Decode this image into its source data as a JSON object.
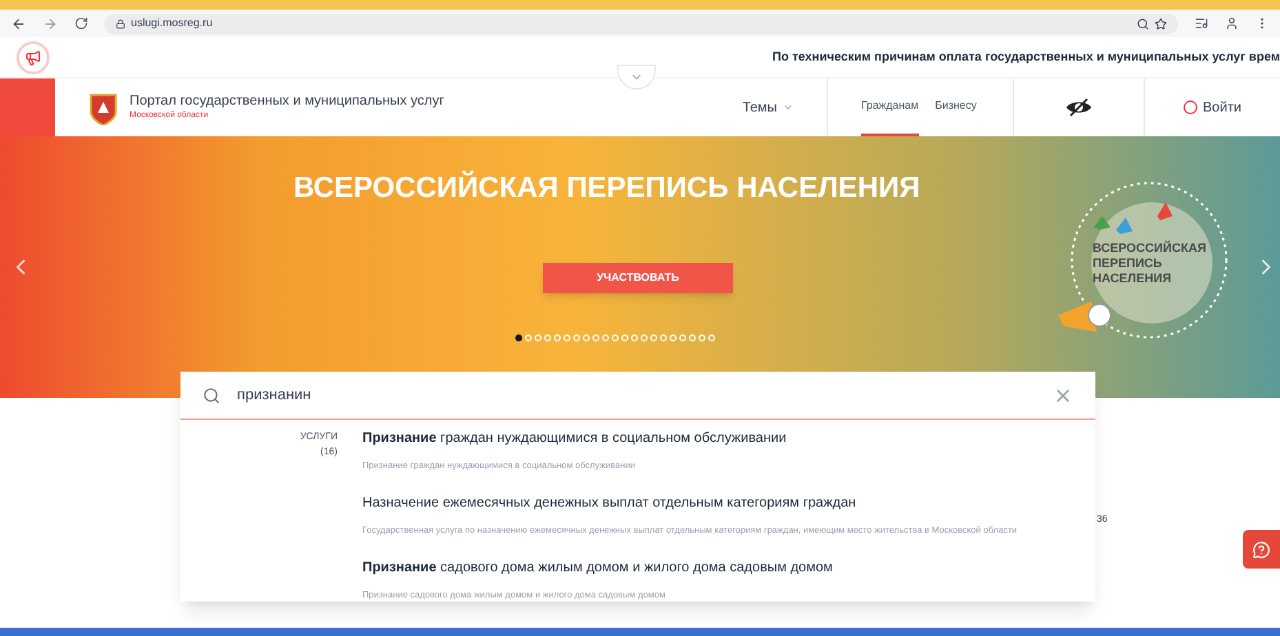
{
  "browser": {
    "url": "uslugi.mosreg.ru"
  },
  "notice": "По техническим причинам оплата государственных и муниципальных услуг врем",
  "header": {
    "title": "Портал государственных и муниципальных услуг",
    "subtitle": "Московской области",
    "topics": "Темы",
    "tabs": [
      {
        "label": "Гражданам",
        "selected": true
      },
      {
        "label": "Бизнесу",
        "selected": false
      }
    ],
    "login": "Войти"
  },
  "banner": {
    "title": "ВСЕРОССИЙСКАЯ ПЕРЕПИСЬ НАСЕЛЕНИЯ",
    "button": "УЧАСТВОВАТЬ",
    "logo_text": "ВСЕРОССИЙСКАЯ ПЕРЕПИСЬ НАСЕЛЕНИЯ",
    "dots": [
      {
        "selected": true
      },
      {
        "selected": false
      },
      {
        "selected": false
      },
      {
        "selected": false
      },
      {
        "selected": false
      },
      {
        "selected": false
      },
      {
        "selected": false
      },
      {
        "selected": false
      },
      {
        "selected": false
      },
      {
        "selected": false
      },
      {
        "selected": false
      },
      {
        "selected": false
      },
      {
        "selected": false
      },
      {
        "selected": false
      },
      {
        "selected": false
      },
      {
        "selected": false
      },
      {
        "selected": false
      },
      {
        "selected": false
      },
      {
        "selected": false
      },
      {
        "selected": false
      },
      {
        "selected": false
      }
    ]
  },
  "search": {
    "value": "признанин"
  },
  "results": {
    "category": "УСЛУГИ",
    "count": "(16)",
    "items": [
      {
        "title": "**Признание** граждан нуждающимися в социальном обслуживании",
        "description": "Признание граждан нуждающимися в социальном обслуживании"
      },
      {
        "title": "Назначение ежемесячных денежных выплат отдельным категориям граждан",
        "description": "Государственная услуга по назначению ежемесячных денежных выплат отдельным категориям граждан, имеющим место жительства в Московской области"
      },
      {
        "title": "**Признание** садового дома жилым домом и жилого дома садовым домом",
        "description": "Признание садового дома жилым домом и жилого дома садовым домом"
      }
    ]
  },
  "side_fragment": "36"
}
